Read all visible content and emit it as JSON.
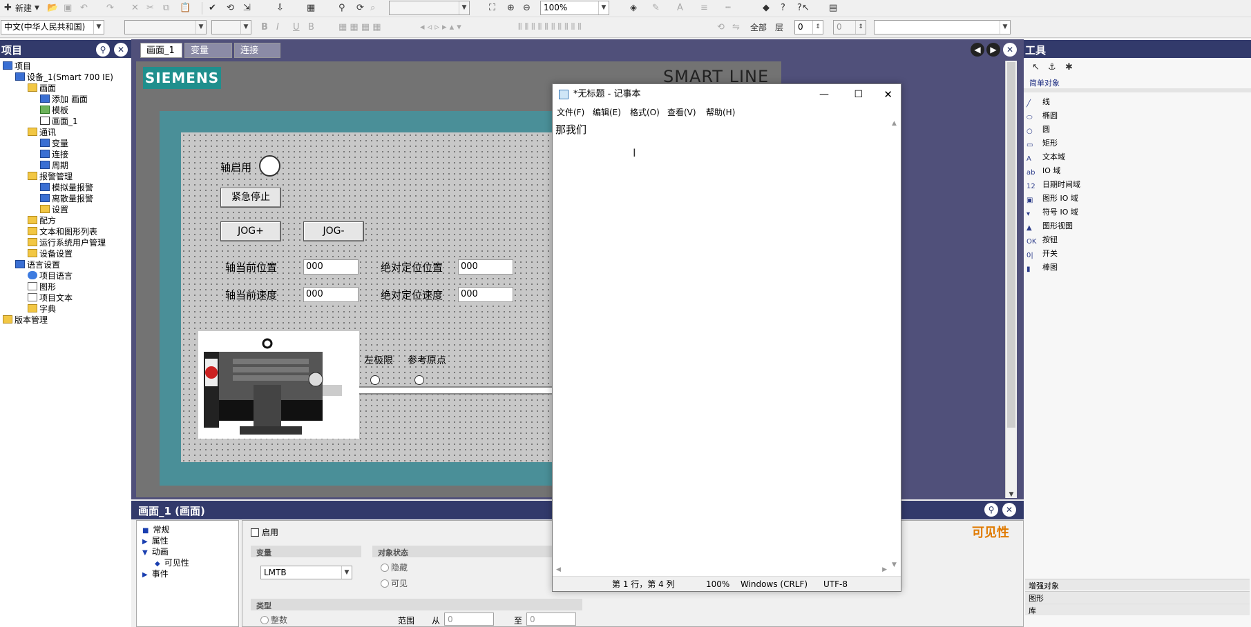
{
  "toolbar": {
    "new_label": "新建",
    "zoom_value": "100%",
    "language_value": "中文(中华人民共和国)",
    "all_label": "全部",
    "layer_label": "层",
    "layer_value": "0",
    "layer_value2": "0"
  },
  "project_panel": {
    "title": "项目",
    "items": [
      {
        "label": "项目",
        "indent": 0,
        "icon": "project-icon"
      },
      {
        "label": "设备_1(Smart 700 IE)",
        "indent": 1,
        "icon": "device-icon"
      },
      {
        "label": "画面",
        "indent": 2,
        "icon": "folder-icon"
      },
      {
        "label": "添加 画面",
        "indent": 3,
        "icon": "add-screen-icon"
      },
      {
        "label": "模板",
        "indent": 3,
        "icon": "template-icon"
      },
      {
        "label": "画面_1",
        "indent": 3,
        "icon": "screen-icon"
      },
      {
        "label": "通讯",
        "indent": 2,
        "icon": "folder-icon"
      },
      {
        "label": "变量",
        "indent": 3,
        "icon": "tag-icon"
      },
      {
        "label": "连接",
        "indent": 3,
        "icon": "connection-icon"
      },
      {
        "label": "周期",
        "indent": 3,
        "icon": "cycle-icon"
      },
      {
        "label": "报警管理",
        "indent": 2,
        "icon": "folder-icon"
      },
      {
        "label": "模拟量报警",
        "indent": 3,
        "icon": "analog-alarm-icon"
      },
      {
        "label": "离散量报警",
        "indent": 3,
        "icon": "discrete-alarm-icon"
      },
      {
        "label": "设置",
        "indent": 3,
        "icon": "folder-icon"
      },
      {
        "label": "配方",
        "indent": 2,
        "icon": "folder-icon"
      },
      {
        "label": "文本和图形列表",
        "indent": 2,
        "icon": "folder-icon"
      },
      {
        "label": "运行系统用户管理",
        "indent": 2,
        "icon": "folder-icon"
      },
      {
        "label": "设备设置",
        "indent": 2,
        "icon": "folder-icon"
      },
      {
        "label": "语言设置",
        "indent": 1,
        "icon": "language-icon"
      },
      {
        "label": "项目语言",
        "indent": 2,
        "icon": "globe-icon"
      },
      {
        "label": "图形",
        "indent": 2,
        "icon": "graphics-icon"
      },
      {
        "label": "项目文本",
        "indent": 2,
        "icon": "document-icon"
      },
      {
        "label": "字典",
        "indent": 2,
        "icon": "folder-icon"
      },
      {
        "label": "版本管理",
        "indent": 0,
        "icon": "folder-icon"
      }
    ]
  },
  "tabs": [
    {
      "label": "画面_1"
    },
    {
      "label": "变量"
    },
    {
      "label": "连接"
    }
  ],
  "hmi": {
    "brand": "SIEMENS",
    "model": "SMART LINE",
    "axis_enable": "轴启用",
    "estop": "紧急停止",
    "jog_plus": "JOG+",
    "jog_minus": "JOG-",
    "cur_pos_label": "轴当前位置",
    "cur_pos_value": "000",
    "abs_pos_label": "绝对定位位置",
    "abs_pos_value": "000",
    "cur_speed_label": "轴当前速度",
    "cur_speed_value": "000",
    "abs_speed_label": "绝对定位速度",
    "abs_speed_value": "000",
    "left_limit": "左极限",
    "ref_point": "参考原点"
  },
  "tools_panel": {
    "title": "工具",
    "section": "简单对象",
    "items": [
      {
        "label": "线",
        "icon": "line-icon"
      },
      {
        "label": "椭圆",
        "icon": "ellipse-icon"
      },
      {
        "label": "圆",
        "icon": "circle-icon"
      },
      {
        "label": "矩形",
        "icon": "rectangle-icon"
      },
      {
        "label": "文本域",
        "icon": "text-field-icon"
      },
      {
        "label": "IO 域",
        "icon": "io-field-icon"
      },
      {
        "label": "日期时间域",
        "icon": "datetime-field-icon"
      },
      {
        "label": "图形 IO 域",
        "icon": "graphic-io-icon"
      },
      {
        "label": "符号 IO 域",
        "icon": "symbolic-io-icon"
      },
      {
        "label": "图形视图",
        "icon": "graphic-view-icon"
      },
      {
        "label": "按钮",
        "icon": "button-icon"
      },
      {
        "label": "开关",
        "icon": "switch-icon"
      },
      {
        "label": "棒图",
        "icon": "bar-icon"
      }
    ],
    "bottom_sections": [
      "增强对象",
      "图形",
      "库"
    ]
  },
  "properties": {
    "title": "画面_1 (画面)",
    "nav": [
      {
        "label": "常规",
        "indent": 0,
        "marker": "■"
      },
      {
        "label": "属性",
        "indent": 0,
        "marker": "▶"
      },
      {
        "label": "动画",
        "indent": 0,
        "marker": "▼"
      },
      {
        "label": "可见性",
        "indent": 1,
        "marker": "◆"
      },
      {
        "label": "事件",
        "indent": 0,
        "marker": "▶"
      }
    ],
    "enable_label": "启用",
    "variable_header": "变量",
    "variable_value": "LMTB",
    "object_state_header": "对象状态",
    "hidden_label": "隐藏",
    "visible_label": "可见",
    "type_header": "类型",
    "integer_label": "整数",
    "range_label": "范围",
    "from_label": "从",
    "from_value": "0",
    "to_label": "至",
    "to_value": "0",
    "section_title": "可见性"
  },
  "notepad": {
    "title": "*无标题 - 记事本",
    "menu": [
      "文件(F)",
      "编辑(E)",
      "格式(O)",
      "查看(V)",
      "帮助(H)"
    ],
    "content": "那我们",
    "status_position": "第 1 行，第 4 列",
    "status_zoom": "100%",
    "status_eol": "Windows (CRLF)",
    "status_encoding": "UTF-8"
  },
  "colors": {
    "panel_title_bg": "#323a6b",
    "editor_bg": "#50507a",
    "hmi_teal": "#4a8f98",
    "siemens_teal": "#1f8f8d",
    "section_title_color": "#e07a00"
  }
}
